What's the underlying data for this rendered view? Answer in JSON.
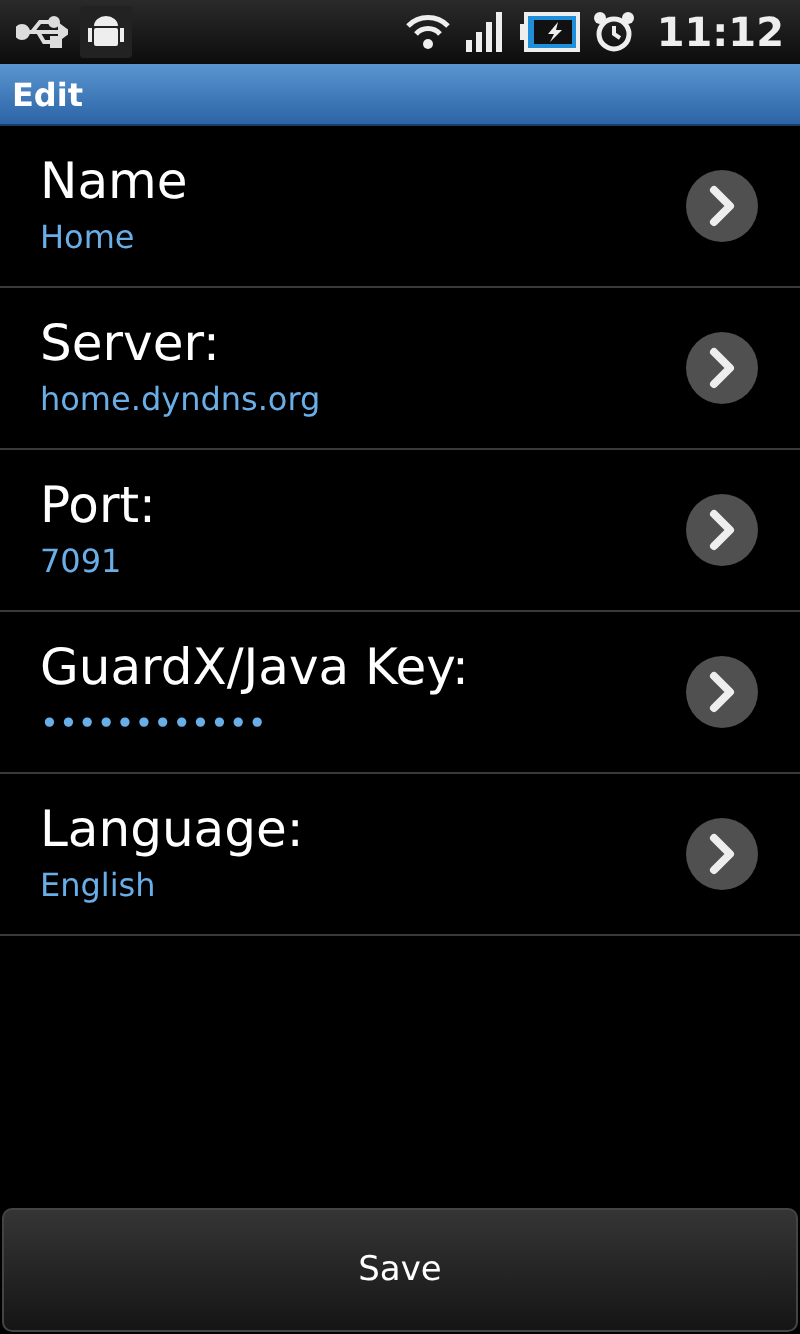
{
  "status_bar": {
    "time": "11:12"
  },
  "title_bar": {
    "title": "Edit"
  },
  "settings": [
    {
      "title": "Name",
      "value": "Home"
    },
    {
      "title": "Server:",
      "value": "home.dyndns.org"
    },
    {
      "title": "Port:",
      "value": "7091"
    },
    {
      "title": "GuardX/Java Key:",
      "value": "••••••••••••"
    },
    {
      "title": "Language:",
      "value": "English"
    }
  ],
  "save_button": {
    "label": "Save"
  }
}
